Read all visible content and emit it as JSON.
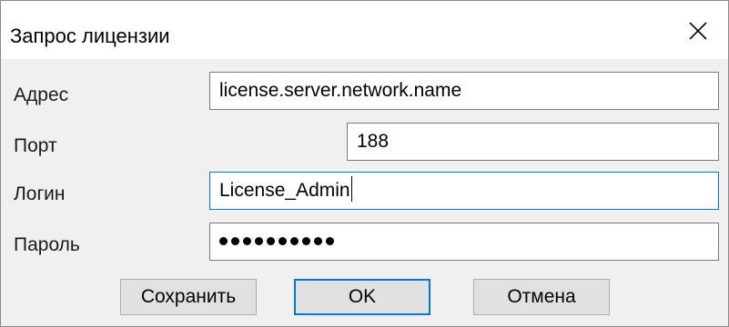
{
  "dialog": {
    "title": "Запрос лицензии",
    "close_glyph": "×"
  },
  "form": {
    "address": {
      "label": "Адрес",
      "value": "license.server.network.name"
    },
    "port": {
      "label": "Порт",
      "value": "188"
    },
    "login": {
      "label": "Логин",
      "value": "License_Admin"
    },
    "password": {
      "label": "Пароль",
      "masked_length": 10
    }
  },
  "buttons": {
    "save": "Сохранить",
    "ok": "OK",
    "cancel": "Отмена"
  },
  "colors": {
    "focus_border": "#0078d7",
    "window_bg": "#f0f0f0",
    "button_bg": "#e1e1e1"
  },
  "icons": {
    "close": "close-icon"
  }
}
